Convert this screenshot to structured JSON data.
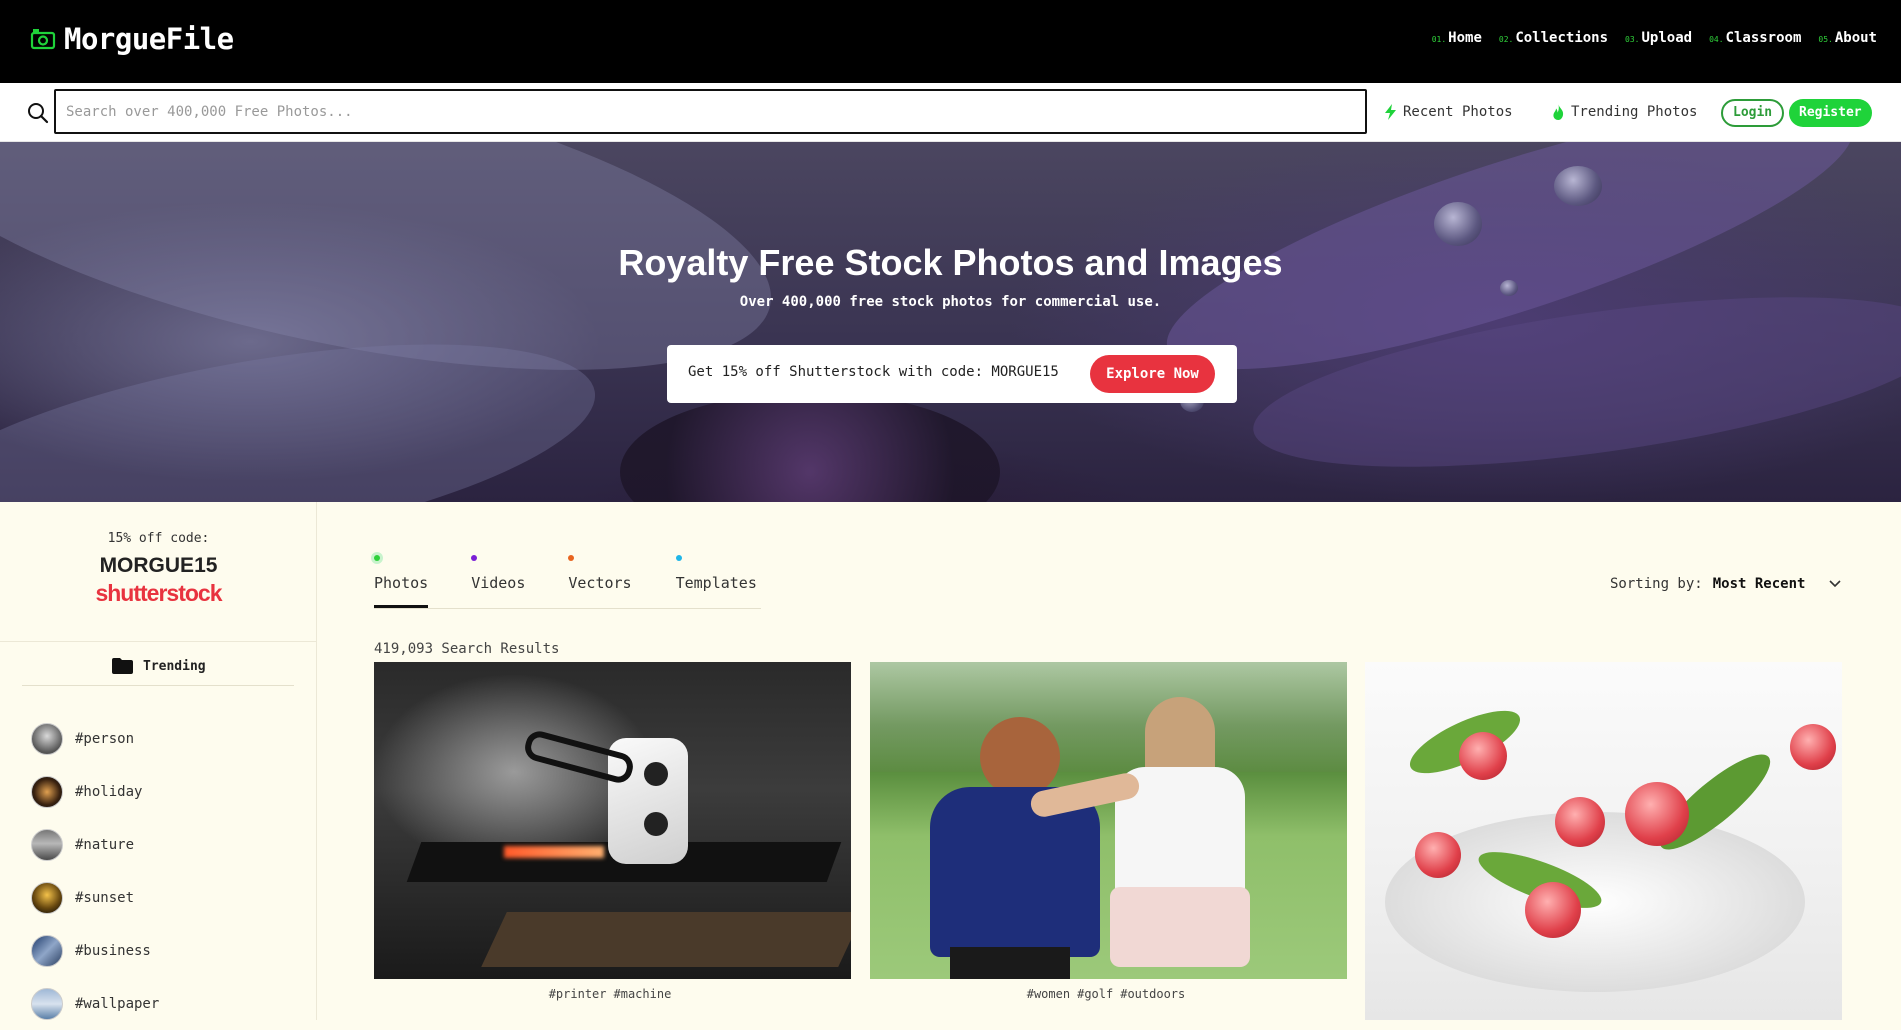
{
  "brand": {
    "name": "MorgueFile",
    "accent": "#1fd33a"
  },
  "nav": [
    {
      "num": "01.",
      "label": "Home"
    },
    {
      "num": "02.",
      "label": "Collections"
    },
    {
      "num": "03.",
      "label": "Upload"
    },
    {
      "num": "04.",
      "label": "Classroom"
    },
    {
      "num": "05.",
      "label": "About"
    }
  ],
  "search": {
    "placeholder": "Search over 400,000 Free Photos...",
    "value": ""
  },
  "quicklinks": {
    "recent": "Recent Photos",
    "trending": "Trending Photos"
  },
  "auth": {
    "login": "Login",
    "register": "Register"
  },
  "hero": {
    "title": "Royalty Free Stock Photos and Images",
    "subtitle": "Over 400,000 free stock photos for commercial use.",
    "promo_text": "Get 15% off Shutterstock with code: MORGUE15",
    "promo_button": "Explore Now"
  },
  "sidebar": {
    "code_label": "15% off code:",
    "code": "MORGUE15",
    "brand": "shutterstock",
    "trending_label": "Trending",
    "tags": [
      {
        "label": "#person"
      },
      {
        "label": "#holiday"
      },
      {
        "label": "#nature"
      },
      {
        "label": "#sunset"
      },
      {
        "label": "#business"
      },
      {
        "label": "#wallpaper"
      }
    ]
  },
  "tabs": [
    {
      "label": "Photos",
      "dot_color": "#2fd13a",
      "active": true
    },
    {
      "label": "Videos",
      "dot_color": "#7a1fd6",
      "active": false
    },
    {
      "label": "Vectors",
      "dot_color": "#e8641f",
      "active": false
    },
    {
      "label": "Templates",
      "dot_color": "#1fb6e8",
      "active": false
    }
  ],
  "sorting": {
    "label": "Sorting by:",
    "value": "Most Recent"
  },
  "results": {
    "count_text": "419,093 Search Results",
    "cards": [
      {
        "tags": [
          "#printer",
          "#machine"
        ]
      },
      {
        "tags": [
          "#women",
          "#golf",
          "#outdoors"
        ]
      },
      {
        "tags": []
      }
    ]
  }
}
